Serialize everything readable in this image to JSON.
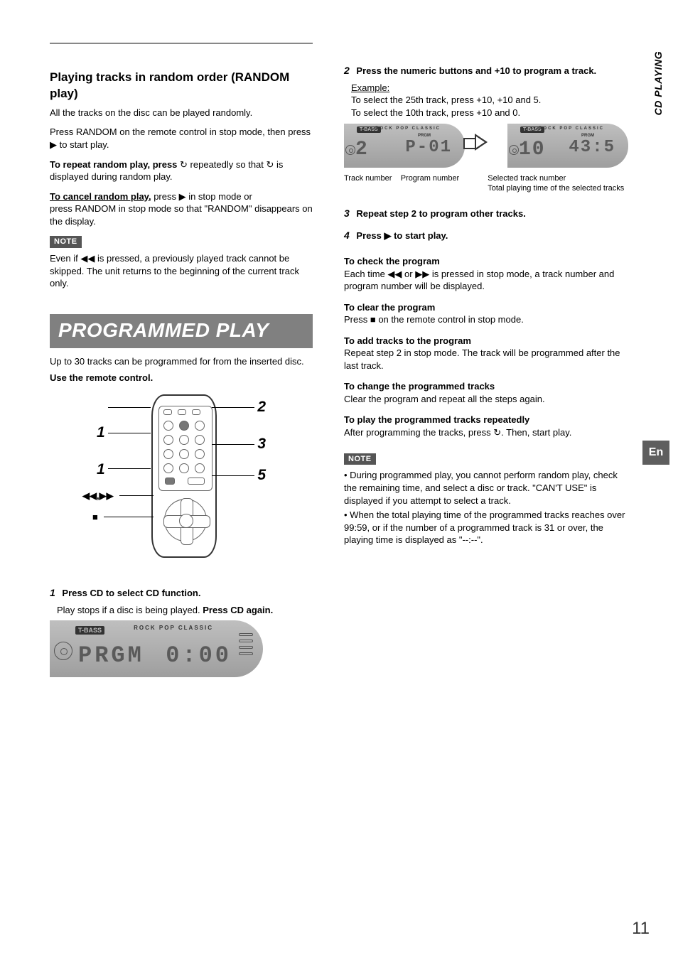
{
  "side": {
    "section": "CD PLAYING",
    "lang": "En"
  },
  "page_number": "11",
  "left": {
    "random_title": "Playing tracks in random order (RANDOM play)",
    "random_intro": "All the tracks on the disc can be played randomly.",
    "random_set": "Press RANDOM on the remote control in stop mode, then press",
    "random_set_tail": "to start play.",
    "random_rpt_title": "To repeat random play, press",
    "random_rpt_body1": "repeatedly so that",
    "random_rpt_body2": "is displayed during random play.",
    "random_cancel": "To cancel random play,",
    "random_cancel_body": "press RANDOM in stop mode so that \"RANDOM\" disappears on the display.",
    "note_label": "NOTE",
    "note_body": "Even if       is pressed, a previously played track cannot be skipped. The unit returns to the beginning of the current track only.",
    "prog_banner": "PROGRAMMED PLAY",
    "prog_intro": "Up to 30 tracks can be programmed for from the inserted disc.",
    "prog_remote": "Use the remote control.",
    "step1a": "Press CD to select CD function.",
    "step1b": "Play stops if a disc is being played.",
    "step1b_bold": "Press CD again.",
    "big_lcd": {
      "tbass": "T-BASS",
      "geq": "ROCK   POP   CLASSIC",
      "main": "PRGM",
      "sub": "0:00"
    }
  },
  "right": {
    "step2_intro": "Press the numeric buttons and +10 to program a track.",
    "step2_ex_title": "Example:",
    "step2_ex1": "To select the 25th track, press +10, +10 and 5.",
    "step2_ex2": "To select the 10th track, press +10 and 0.",
    "small_lcd_left": {
      "track": "2",
      "time": "P-01"
    },
    "small_lcd_right": {
      "track": "10",
      "time": "43:5"
    },
    "small_caption_left": "Track number",
    "small_caption_left2": "Selected track number",
    "small_caption_right": "Program number",
    "small_caption_right2": "Total playing time of the selected tracks",
    "step3": "Repeat step 2 to program other tracks.",
    "step4": "Press      to start play.",
    "post_title": "To check the program",
    "post_body1": "Each time      or      is pressed in stop mode, a track number and program number will be displayed.",
    "clear_title": "To clear the program",
    "clear_body": "Press     on the remote control in stop mode.",
    "add_title": "To add tracks to the program",
    "add_body": "Repeat step 2 in stop mode. The track will be programmed after the last track.",
    "change_title": "To change the programmed tracks",
    "change_body": "Clear the program and repeat all the steps again.",
    "rpt_title": "To play the programmed tracks repeatedly",
    "rpt_body": "After programming the tracks, press     . Then, start play.",
    "note2_label": "NOTE",
    "note2_li1": "During programmed play, you cannot perform random play, check the remaining time, and select a disc or track. \"CAN'T USE\" is displayed if you attempt to select a track.",
    "note2_li2": "When the total playing time of the programmed tracks reaches over 99:59, or if the number of a programmed track is 31 or over, the playing time is displayed as \"--:--\"."
  },
  "remote_labels": {
    "n2": "2",
    "n1a": "1",
    "n3": "3",
    "n1b": "1",
    "n5": "5"
  }
}
